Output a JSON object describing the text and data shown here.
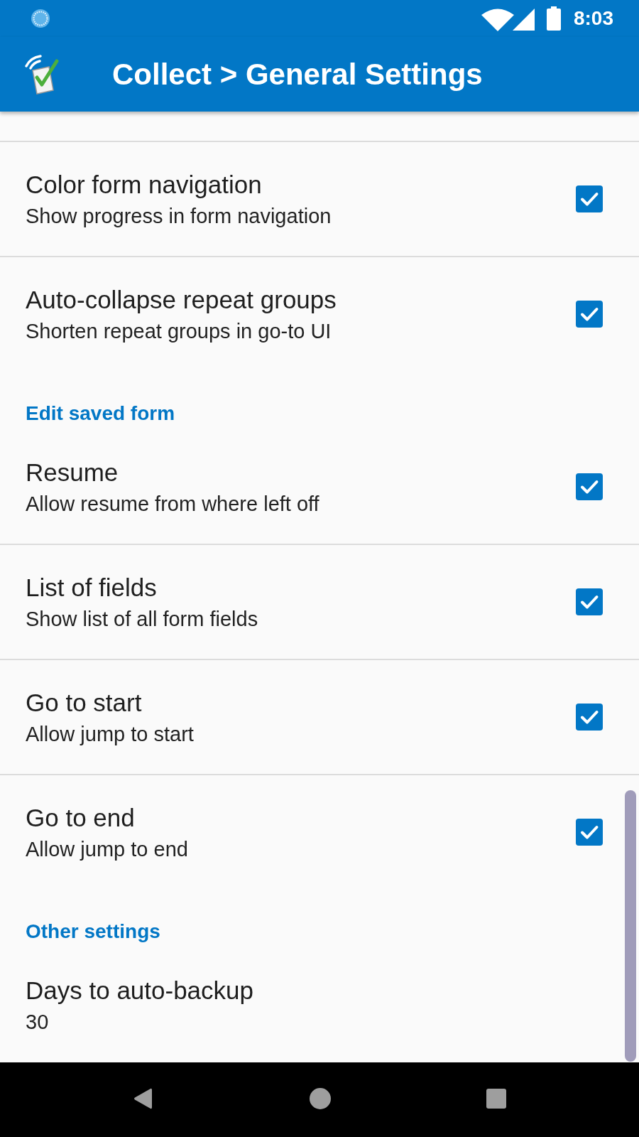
{
  "status_bar": {
    "time": "8:03"
  },
  "app_bar": {
    "title": "Collect > General Settings"
  },
  "sections": [
    {
      "items": [
        {
          "kind": "checkbox",
          "title": "Color form navigation",
          "summary": "Show progress in form navigation",
          "checked": true
        },
        {
          "kind": "checkbox",
          "title": "Auto-collapse repeat groups",
          "summary": "Shorten repeat groups in go-to UI",
          "checked": true
        }
      ]
    },
    {
      "header": "Edit saved form",
      "items": [
        {
          "kind": "checkbox",
          "title": "Resume",
          "summary": "Allow resume from where left off",
          "checked": true
        },
        {
          "kind": "checkbox",
          "title": "List of fields",
          "summary": "Show list of all form fields",
          "checked": true
        },
        {
          "kind": "checkbox",
          "title": "Go to start",
          "summary": "Allow jump to start",
          "checked": true
        },
        {
          "kind": "checkbox",
          "title": "Go to end",
          "summary": "Allow jump to end",
          "checked": true
        }
      ]
    },
    {
      "header": "Other settings",
      "items": [
        {
          "kind": "value",
          "title": "Days to auto-backup",
          "summary": "30"
        }
      ]
    }
  ]
}
